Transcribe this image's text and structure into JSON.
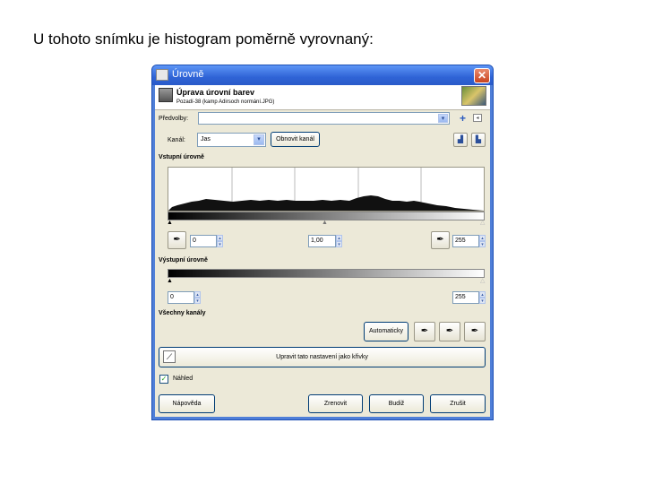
{
  "heading": "U tohoto snímku je histogram poměrně vyrovnaný:",
  "window": {
    "title": "Úrovně",
    "close_glyph": "✕",
    "icon": "levels-icon"
  },
  "header": {
    "title": "Úprava úrovní barev",
    "subtitle": "Pozadí-38 (kamp Adirsoch normání.JPG)"
  },
  "presets": {
    "label": "Předvolby:",
    "value": "",
    "add_icon": "plus-icon",
    "menu_icon": "menu-icon"
  },
  "channel": {
    "label": "Kanál:",
    "value": "Jas",
    "reset_label": "Obnovit kanál"
  },
  "input_levels": {
    "label": "Vstupní úrovně",
    "low": "0",
    "gamma": "1,00",
    "high": "255"
  },
  "output_levels": {
    "label": "Výstupní úrovně",
    "low": "0",
    "high": "255"
  },
  "all_channels": {
    "label": "Všechny kanály",
    "auto_label": "Automaticky"
  },
  "curves_button_label": "Upravit tato nastavení jako křivky",
  "preview": {
    "label": "Náhled",
    "checked": true
  },
  "buttons": {
    "help": "Nápověda",
    "reset": "Zrenovit",
    "ok": "Budiž",
    "cancel": "Zrušit"
  },
  "colors": {
    "titlebar": "#2f63d6",
    "client": "#ece9d8"
  }
}
